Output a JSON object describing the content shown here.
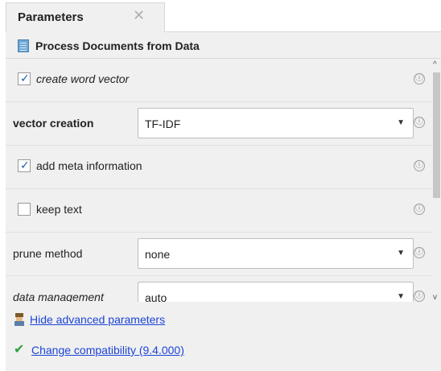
{
  "tab": {
    "label": "Parameters",
    "close_glyph": "✕"
  },
  "operator": {
    "title": "Process Documents from Data",
    "icon": "document-icon"
  },
  "params": {
    "create_word_vector": {
      "label": "create word vector",
      "checked": true
    },
    "vector_creation": {
      "label": "vector creation",
      "value": "TF-IDF"
    },
    "add_meta_information": {
      "label": "add meta information",
      "checked": true
    },
    "keep_text": {
      "label": "keep text",
      "checked": false
    },
    "prune_method": {
      "label": "prune method",
      "value": "none"
    },
    "data_management": {
      "label": "data management",
      "value": "auto"
    }
  },
  "info_glyph": "ⓘ",
  "dropdown_glyph": "▼",
  "scroll": {
    "up_glyph": "^",
    "down_glyph": "v"
  },
  "footer": {
    "advanced_link": "Hide advanced parameters",
    "compat_link": "Change compatibility (9.4.000)"
  },
  "colors": {
    "link": "#1c44d6",
    "check": "#1a5fb4",
    "tick": "#2e9e3e",
    "panel_bg": "#f0f0f0"
  }
}
